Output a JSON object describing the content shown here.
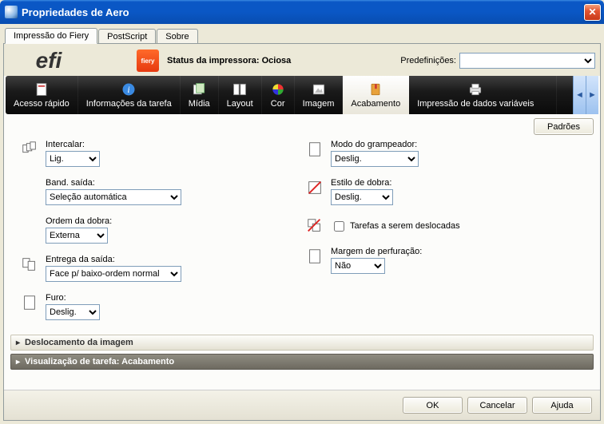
{
  "window": {
    "title": "Propriedades de Aero"
  },
  "tabs": {
    "fiery": "Impressão do Fiery",
    "postscript": "PostScript",
    "about": "Sobre"
  },
  "header": {
    "efi": "efi",
    "fiery": "fiery",
    "status": "Status da impressora: Ociosa",
    "presets_label": "Predefinições:"
  },
  "toolbar": {
    "quick": "Acesso rápido",
    "jobinfo": "Informações da tarefa",
    "media": "Mídia",
    "layout": "Layout",
    "color": "Cor",
    "image": "Imagem",
    "finish": "Acabamento",
    "vdp": "Impressão de dados variáveis"
  },
  "buttons": {
    "defaults": "Padrões",
    "ok": "OK",
    "cancel": "Cancelar",
    "help": "Ajuda"
  },
  "fields": {
    "collate": {
      "label": "Intercalar:",
      "value": "Lig."
    },
    "output_tray": {
      "label": "Band. saída:",
      "value": "Seleção automática"
    },
    "fold_order": {
      "label": "Ordem da dobra:",
      "value": "Externa"
    },
    "delivery": {
      "label": "Entrega da saída:",
      "value": "Face p/ baixo-ordem normal"
    },
    "punch": {
      "label": "Furo:",
      "value": "Deslig."
    },
    "stapler": {
      "label": "Modo do grampeador:",
      "value": "Deslig."
    },
    "fold_style": {
      "label": "Estilo de dobra:",
      "value": "Deslig."
    },
    "offset_jobs": {
      "label": "Tarefas a serem deslocadas"
    },
    "punch_margin": {
      "label": "Margem de perfuração:",
      "value": "Não"
    }
  },
  "bars": {
    "shift": "Deslocamento da imagem",
    "preview": "Visualização de tarefa: Acabamento"
  }
}
